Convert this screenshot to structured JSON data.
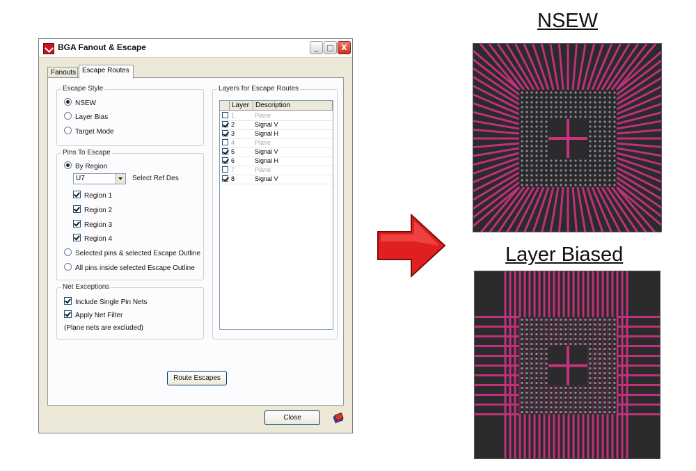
{
  "window": {
    "title": "BGA Fanout & Escape",
    "min_symbol": "_",
    "max_symbol": "□",
    "close_symbol": "X"
  },
  "tabs": [
    {
      "label": "Fanouts",
      "active": false
    },
    {
      "label": "Escape Routes",
      "active": true
    }
  ],
  "escape_style": {
    "label": "Escape Style",
    "options": [
      {
        "label": "NSEW",
        "selected": true
      },
      {
        "label": "Layer Bias",
        "selected": false
      },
      {
        "label": "Target Mode",
        "selected": false
      }
    ]
  },
  "pins_to_escape": {
    "label": "Pins To Escape",
    "by_region": "By Region",
    "ref_des_value": "U7",
    "select_ref_des": "Select Ref Des",
    "regions": [
      {
        "label": "Region 1",
        "checked": true
      },
      {
        "label": "Region 2",
        "checked": true
      },
      {
        "label": "Region 3",
        "checked": true
      },
      {
        "label": "Region 4",
        "checked": true
      }
    ],
    "selected_pins": "Selected pins & selected Escape Outline",
    "all_pins": "All pins inside selected Escape Outline"
  },
  "net_exceptions": {
    "label": "Net Exceptions",
    "include_single": "Include Single Pin Nets",
    "apply_filter": "Apply Net Filter",
    "note": "(Plane nets are excluded)"
  },
  "layers": {
    "label": "Layers for Escape Routes",
    "col_layer": "Layer",
    "col_desc": "Description",
    "rows": [
      {
        "layer": "1",
        "desc": "Plane",
        "checked": false,
        "enabled": false
      },
      {
        "layer": "2",
        "desc": "Signal V",
        "checked": true,
        "enabled": true
      },
      {
        "layer": "3",
        "desc": "Signal H",
        "checked": true,
        "enabled": true
      },
      {
        "layer": "4",
        "desc": "Plane",
        "checked": false,
        "enabled": false
      },
      {
        "layer": "5",
        "desc": "Signal V",
        "checked": true,
        "enabled": true
      },
      {
        "layer": "6",
        "desc": "Signal H",
        "checked": true,
        "enabled": true
      },
      {
        "layer": "7",
        "desc": "Plane",
        "checked": false,
        "enabled": false
      },
      {
        "layer": "8",
        "desc": "Signal V",
        "checked": true,
        "enabled": true
      }
    ]
  },
  "route_button": "Route Escapes",
  "close_button": "Close",
  "result_titles": {
    "top": "NSEW",
    "bottom": "Layer Biased"
  },
  "colors": {
    "trace": "#c8327f",
    "board_bg": "#2b2a2d",
    "arrow": "#e01f1f"
  }
}
